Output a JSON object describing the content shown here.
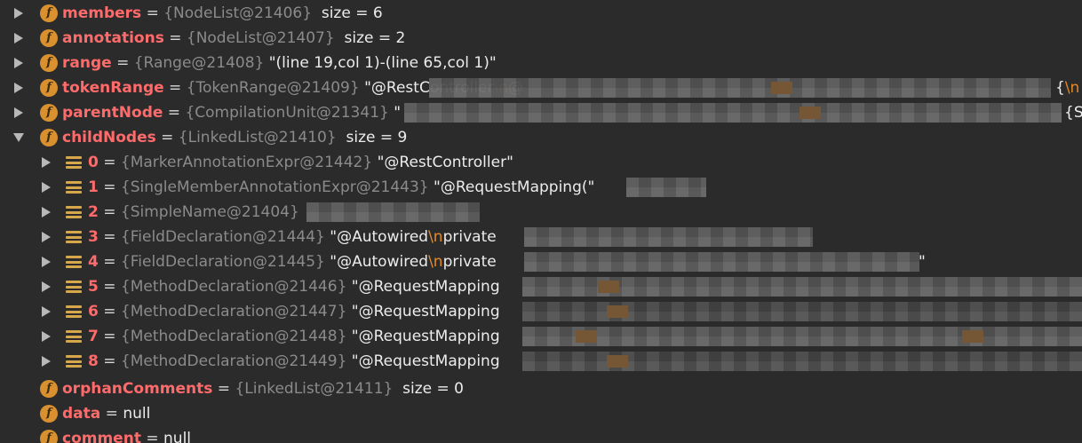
{
  "colors": {
    "background": "#2b2b2b",
    "field_name": "#ff6b6b",
    "type_ref": "#8b8b8b",
    "value": "#ececec",
    "escape": "#e08a2a",
    "field_icon": "#d9902f",
    "list_icon": "#d6a74b"
  },
  "icons": {
    "field": "field-icon",
    "list_element": "list-element-icon",
    "expand": "expand-arrow-icon",
    "collapse": "collapse-arrow-icon"
  },
  "rows": [
    {
      "name": "members",
      "op": " = ",
      "type": "{NodeList@21406}",
      "value": "size = 6"
    },
    {
      "name": "annotations",
      "op": " = ",
      "type": "{NodeList@21407}",
      "value": "size = 2"
    },
    {
      "name": "range",
      "op": " = ",
      "type": "{Range@21408}",
      "value": "\"(line 19,col 1)-(line 65,col 1)\""
    },
    {
      "name": "tokenRange",
      "op": " = ",
      "type": "{TokenRange@21409}",
      "value": "\"@RestController",
      "esc": "\\n",
      "value_tail": "@",
      "value_right": "{",
      "esc_right": "\\n"
    },
    {
      "name": "parentNode",
      "op": " = ",
      "type": "{CompilationUnit@21341}",
      "value": "\"",
      "value_right": "{S"
    },
    {
      "name": "childNodes",
      "op": " = ",
      "type": "{LinkedList@21410}",
      "value": "size = 9"
    },
    {
      "name": "0",
      "op": " = ",
      "type": "{MarkerAnnotationExpr@21442}",
      "value": "\"@RestController\""
    },
    {
      "name": "1",
      "op": " = ",
      "type": "{SingleMemberAnnotationExpr@21443}",
      "value": "\"@RequestMapping(\""
    },
    {
      "name": "2",
      "op": " = ",
      "type": "{SimpleName@21404}",
      "value": ""
    },
    {
      "name": "3",
      "op": " = ",
      "type": "{FieldDeclaration@21444}",
      "value": "\"@Autowired",
      "esc": "\\n",
      "value_tail": "private"
    },
    {
      "name": "4",
      "op": " = ",
      "type": "{FieldDeclaration@21445}",
      "value": "\"@Autowired",
      "esc": "\\n",
      "value_tail": "private",
      "value_right": "\""
    },
    {
      "name": "5",
      "op": " = ",
      "type": "{MethodDeclaration@21446}",
      "value": "\"@RequestMapping"
    },
    {
      "name": "6",
      "op": " = ",
      "type": "{MethodDeclaration@21447}",
      "value": "\"@RequestMapping"
    },
    {
      "name": "7",
      "op": " = ",
      "type": "{MethodDeclaration@21448}",
      "value": "\"@RequestMapping"
    },
    {
      "name": "8",
      "op": " = ",
      "type": "{MethodDeclaration@21449}",
      "value": "\"@RequestMapping"
    },
    {
      "name": "orphanComments",
      "op": " = ",
      "type": "{LinkedList@21411}",
      "value": "size = 0"
    },
    {
      "name": "data",
      "op": " = ",
      "type": "",
      "value": "null"
    },
    {
      "name": "comment",
      "op": " = ",
      "type": "",
      "value": "null"
    }
  ]
}
